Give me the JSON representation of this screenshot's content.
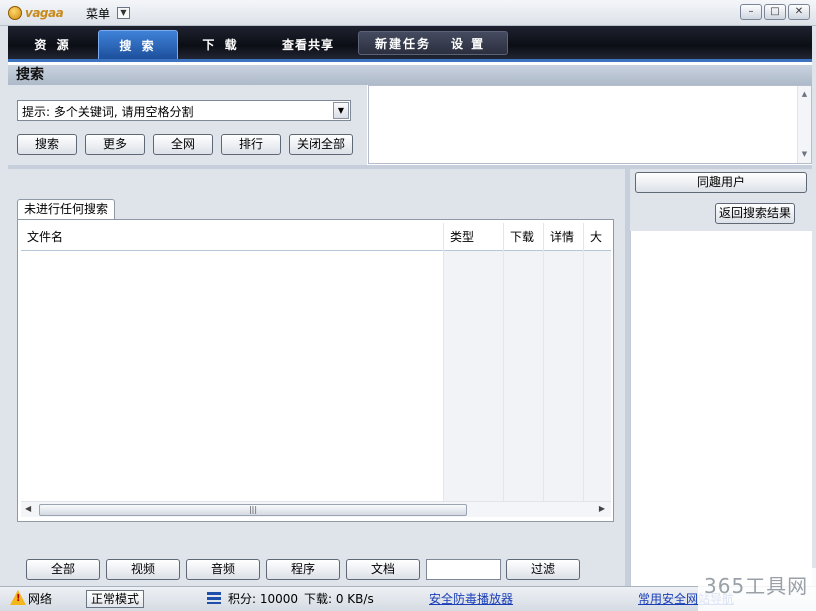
{
  "app": {
    "logo_text": "vagaa",
    "menu_label": "菜单"
  },
  "window_controls": {
    "minimize": "–",
    "maximize": "□",
    "close": "✕"
  },
  "nav": {
    "tabs": [
      "资 源",
      "搜 索",
      "下 载",
      "查看共享"
    ],
    "active_index": 1,
    "group": [
      "新建任务",
      "设 置"
    ]
  },
  "section": {
    "title": "搜索"
  },
  "search": {
    "hint": "提示: 多个关键词, 请用空格分割",
    "buttons": [
      "搜索",
      "更多",
      "全网",
      "排行",
      "关闭全部"
    ]
  },
  "results": {
    "tab_label": "未进行任何搜索",
    "columns": [
      "文件名",
      "类型",
      "下载",
      "详情",
      "大小"
    ]
  },
  "filters": {
    "buttons": [
      "全部",
      "视频",
      "音频",
      "程序",
      "文档"
    ],
    "filter_button": "过滤",
    "input_value": ""
  },
  "right_panel": {
    "peers_button": "同趣用户",
    "back_button": "返回搜索结果"
  },
  "status": {
    "network": "网络",
    "mode": "正常模式",
    "points": "积分: 10000",
    "download_speed": "下载: 0 KB/s",
    "antivirus_link": "安全防毒播放器",
    "safe_sites_link": "常用安全网站导航"
  },
  "watermark": "365工具网",
  "colors": {
    "nav_active": "#2f6cc4",
    "nav_bg": "#141722",
    "panel_bg": "#dfe4eb",
    "link": "#1a3eb8"
  }
}
